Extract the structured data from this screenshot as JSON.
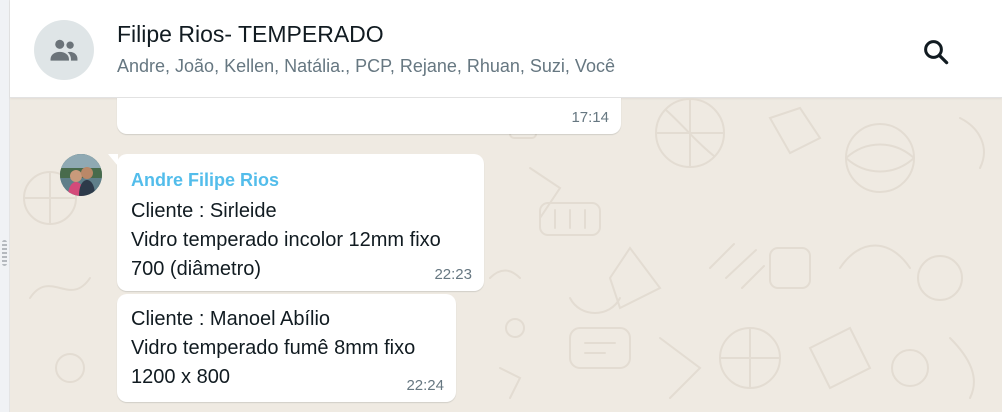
{
  "header": {
    "title": "Filipe Rios- TEMPERADO",
    "participants": "Andre, João, Kellen, Natália., PCP, Rejane, Rhuan, Suzi, Você",
    "avatar_icon": "group-icon",
    "search_icon": "search-icon"
  },
  "colors": {
    "background": "#efeae2",
    "bubble": "#ffffff",
    "sender": "#53bdeb",
    "meta": "#667781"
  },
  "messages": [
    {
      "time": "17:14"
    },
    {
      "sender": "Andre Filipe Rios",
      "lines": [
        "Cliente : Sirleide",
        "Vidro temperado incolor 12mm fixo",
        "700 (diâmetro)"
      ],
      "time": "22:23"
    },
    {
      "lines": [
        "Cliente : Manoel Abílio",
        "Vidro temperado fumê 8mm fixo",
        "1200 x 800"
      ],
      "time": "22:24"
    }
  ]
}
